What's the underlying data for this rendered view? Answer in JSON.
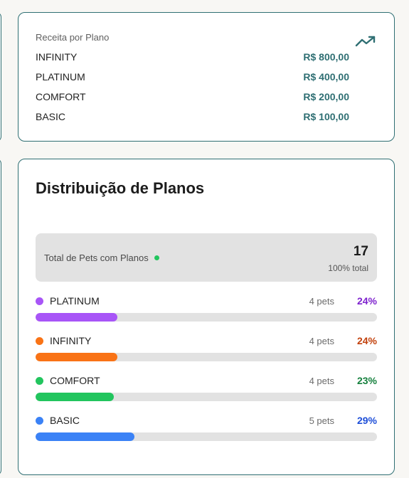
{
  "revenue": {
    "title": "Receita por Plano",
    "icon": "trending-up-icon",
    "accent": "#2f6f73",
    "rows": [
      {
        "plan": "INFINITY",
        "value": "R$ 800,00"
      },
      {
        "plan": "PLATINUM",
        "value": "R$ 400,00"
      },
      {
        "plan": "COMFORT",
        "value": "R$ 200,00"
      },
      {
        "plan": "BASIC",
        "value": "R$ 100,00"
      }
    ]
  },
  "distribution": {
    "title": "Distribuição de Planos",
    "total_label": "Total de Pets com Planos",
    "total_count": "17",
    "total_sub": "100% total",
    "plans": [
      {
        "name": "PLATINUM",
        "pets": "4 pets",
        "percent": "24%",
        "fill": 0.24,
        "color": "#a855f7",
        "pct_color": "#7e22ce"
      },
      {
        "name": "INFINITY",
        "pets": "4 pets",
        "percent": "24%",
        "fill": 0.24,
        "color": "#f97316",
        "pct_color": "#c2410c"
      },
      {
        "name": "COMFORT",
        "pets": "4 pets",
        "percent": "23%",
        "fill": 0.23,
        "color": "#22c55e",
        "pct_color": "#15803d"
      },
      {
        "name": "BASIC",
        "pets": "5 pets",
        "percent": "29%",
        "fill": 0.29,
        "color": "#3b82f6",
        "pct_color": "#1d4ed8"
      }
    ]
  }
}
